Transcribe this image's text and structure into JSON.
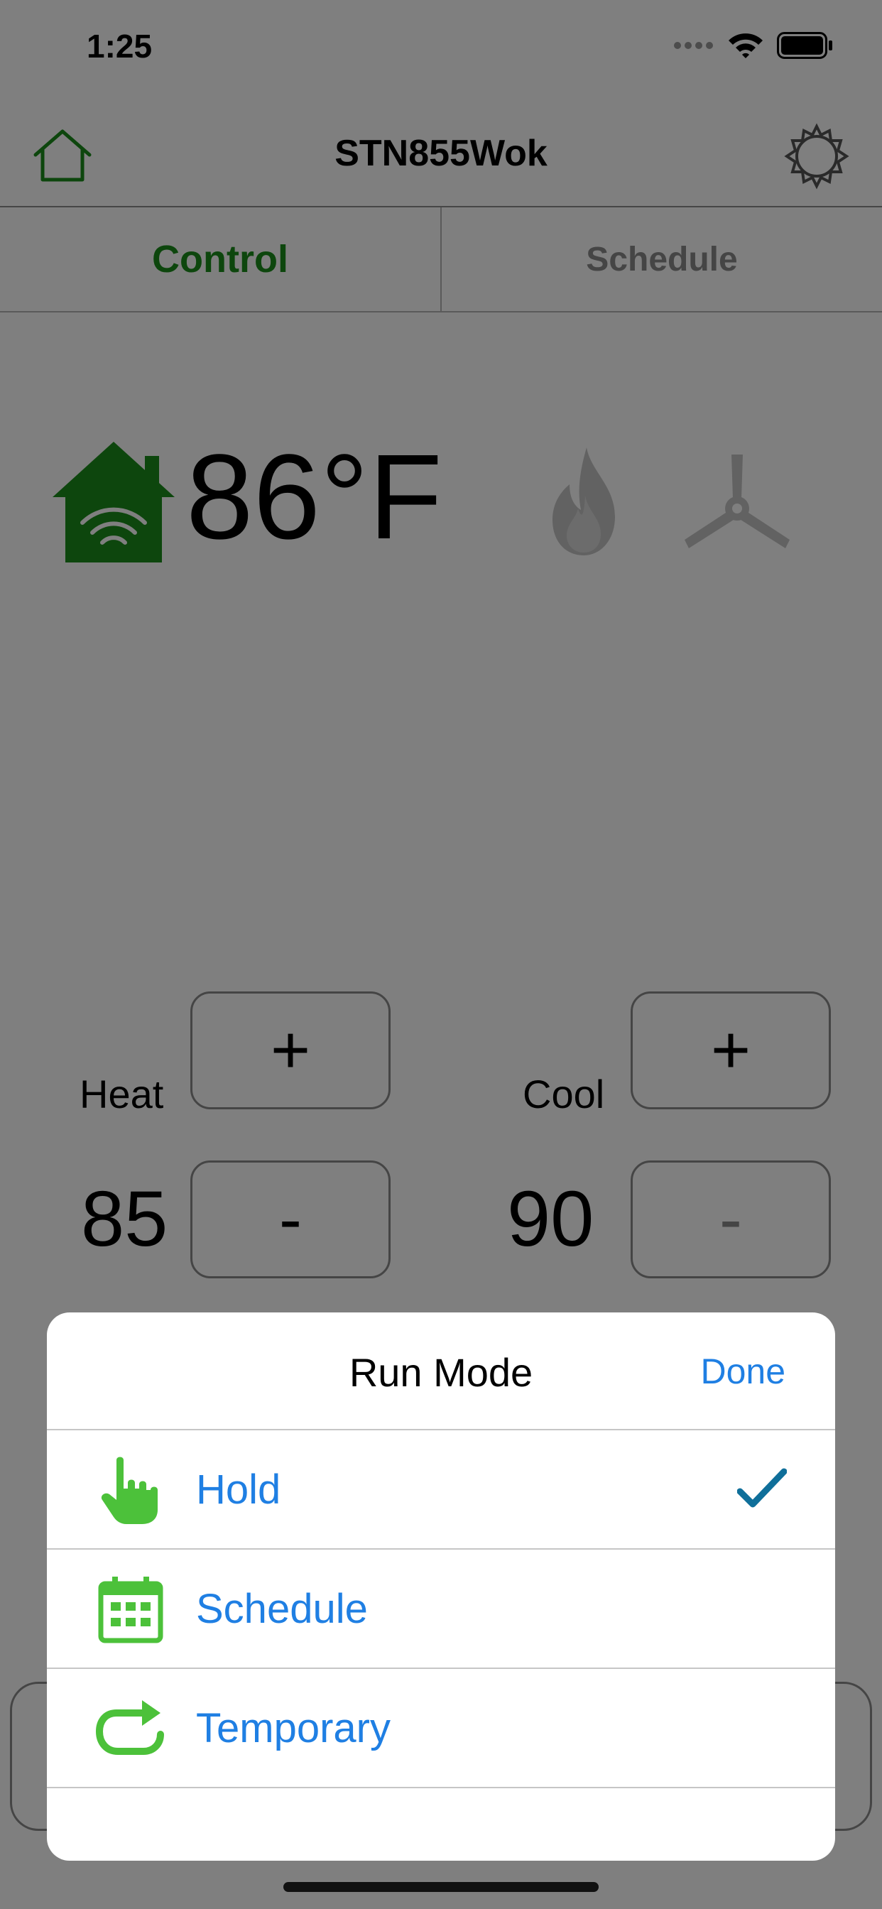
{
  "status_bar": {
    "time": "1:25"
  },
  "header": {
    "title": "STN855Wok"
  },
  "tabs": [
    {
      "label": "Control",
      "active": true
    },
    {
      "label": "Schedule",
      "active": false
    }
  ],
  "current": {
    "temperature": "86°F"
  },
  "setpoints": {
    "heat": {
      "label": "Heat",
      "value": "85",
      "plus": "+",
      "minus": "-"
    },
    "cool": {
      "label": "Cool",
      "value": "90",
      "plus": "+",
      "minus": "-"
    }
  },
  "run_mode_sheet": {
    "title": "Run Mode",
    "done_label": "Done",
    "options": [
      {
        "label": "Hold",
        "icon": "hand-pointer-icon",
        "selected": true
      },
      {
        "label": "Schedule",
        "icon": "calendar-icon",
        "selected": false
      },
      {
        "label": "Temporary",
        "icon": "repeat-arrow-icon",
        "selected": false
      }
    ]
  },
  "colors": {
    "accent_green": "#1a8d1a",
    "icon_green": "#4cc13a",
    "link_blue": "#1f7fe3",
    "check_blue": "#0f6f9a"
  }
}
